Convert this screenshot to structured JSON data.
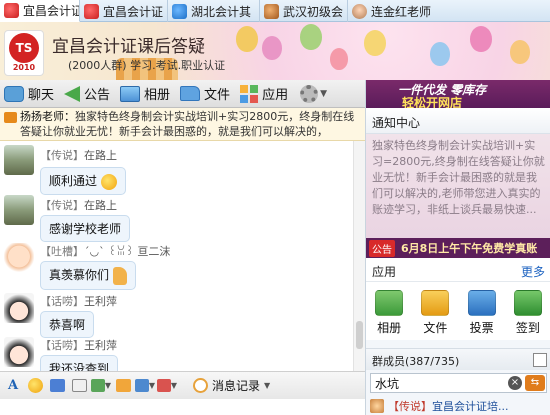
{
  "tabs": [
    {
      "label": "宜昌会计证",
      "icon": "group-logo-icon",
      "active": true
    },
    {
      "label": "宜昌会计证",
      "icon": "group-logo-icon",
      "active": false
    },
    {
      "label": "湖北会计其",
      "icon": "group-icon",
      "active": false
    },
    {
      "label": "武汉初级会",
      "icon": "group-icon",
      "active": false
    },
    {
      "label": "连金红老师",
      "icon": "avatar-icon",
      "active": false
    }
  ],
  "header": {
    "logo_text": "TS",
    "logo_year": "2010",
    "title": "宜昌会计证课后答疑",
    "subtitle": "(2000人群) 学习.考试.职业认证"
  },
  "toolbar": {
    "chat": "聊天",
    "notice": "公告",
    "album": "相册",
    "files": "文件",
    "apps": "应用"
  },
  "announcement": {
    "speaker": "扬扬老师：",
    "text": "独家特色终身制会计实战培训+实习2800元，终身制在线答疑让你就业无忧！新手会计最困惑的，就是我们可以解决的，"
  },
  "messages": [
    {
      "role": "【传说】",
      "name": "在路上",
      "text": "顺利通过",
      "emoji": true
    },
    {
      "role": "【传说】",
      "name": "在路上",
      "text": "感谢学校老师"
    },
    {
      "role": "【吐槽】",
      "name": "ˊ◡ˋ ꒰ꈍ꒱ 亘二沫",
      "text": "真羡慕你们",
      "thumbs": true
    },
    {
      "role": "【话唠】",
      "name": "王利萍",
      "text": "恭喜啊"
    },
    {
      "role": "【话唠】",
      "name": "王利萍",
      "text": "我还没查到"
    }
  ],
  "bottom_toolbar": {
    "font": "A",
    "history": "消息记录"
  },
  "right": {
    "ad_line1": "一件代发 零库存",
    "ad_line2": "轻松开网店",
    "notice_title": "通知中心",
    "notice_body": "独家特色终身制会计实战培训+实习=2800元,终身制在线答疑让你就业无忧！新手会计最困惑的就是我们可以解决的,老师带您进入真实的账迹学习，非纸上谈兵最易快速...",
    "notice_tag": "公告",
    "notice_bar": "6月8日上午下午免费学真账",
    "apps_title": "应用",
    "apps_more": "更多",
    "apps": [
      "相册",
      "文件",
      "投票",
      "签到"
    ],
    "members": "群成员(387/735)",
    "search_value": "水坑",
    "member_role": "【传说】",
    "member_name": "宜昌会计证培..."
  }
}
